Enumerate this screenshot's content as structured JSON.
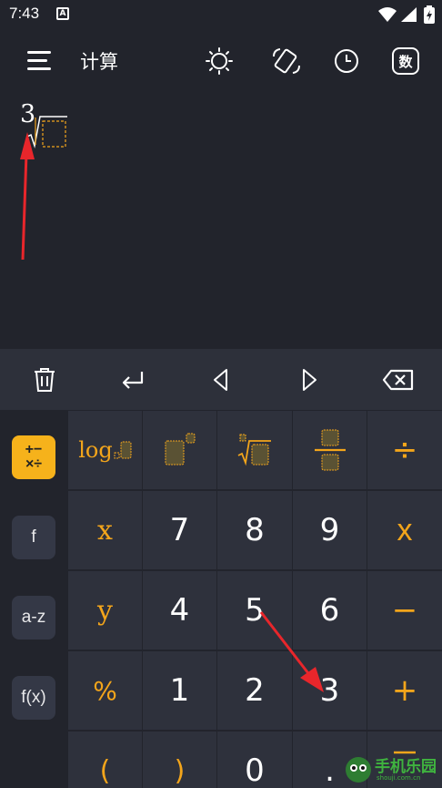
{
  "status_bar": {
    "time": "7:43",
    "notification": "A"
  },
  "app_bar": {
    "title": "计算",
    "icons": [
      "menu-icon",
      "brightness-icon",
      "rotate-icon",
      "history-icon",
      "number-mode-icon"
    ],
    "number_mode_label": "数"
  },
  "display": {
    "root_index": "3"
  },
  "nav_row": [
    "trash-icon",
    "enter-icon",
    "left-arrow-icon",
    "right-arrow-icon",
    "backspace-icon"
  ],
  "sidebar": {
    "items": [
      {
        "label": "+−\n×÷",
        "line1": "+−",
        "line2": "×÷",
        "active": true
      },
      {
        "label": "f"
      },
      {
        "label": "a-z"
      },
      {
        "label": "f(x)"
      }
    ]
  },
  "keypad": {
    "function_row": {
      "log": "log",
      "divide": "÷"
    },
    "rows": [
      [
        "x",
        "7",
        "8",
        "9",
        "x"
      ],
      [
        "y",
        "4",
        "5",
        "6",
        "−"
      ],
      [
        "%",
        "1",
        "2",
        "3",
        "+"
      ],
      [
        "(",
        ")",
        "0",
        ".",
        ""
      ]
    ]
  },
  "watermark": {
    "text": "手机乐园",
    "sub": "shouji.com.cn"
  },
  "colors": {
    "accent": "#f3a51b",
    "background": "#22242c",
    "key": "#2e313c",
    "active_tab": "#f6b21b"
  }
}
